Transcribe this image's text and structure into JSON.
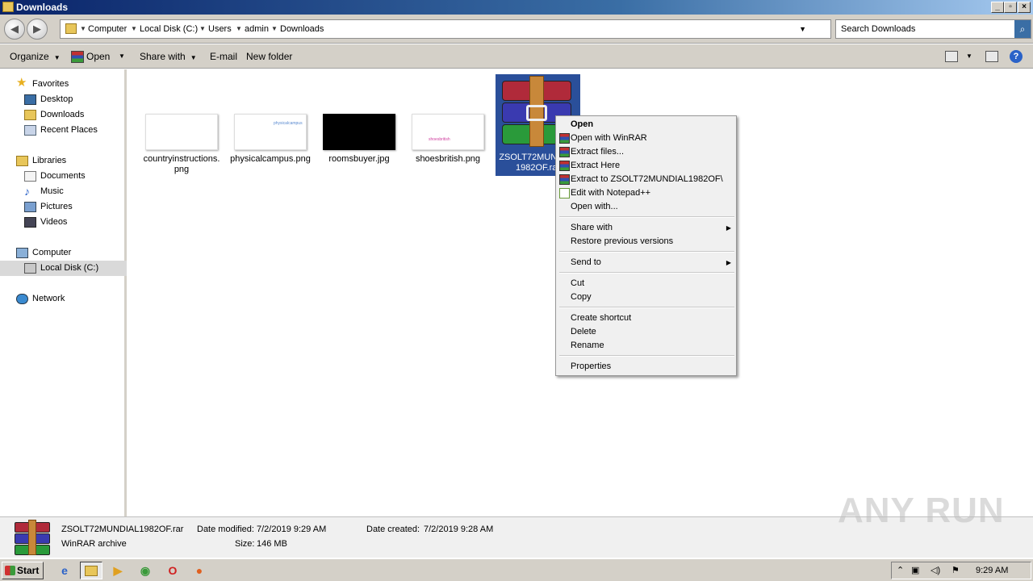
{
  "window": {
    "title": "Downloads"
  },
  "address": {
    "path": [
      "Computer",
      "Local Disk (C:)",
      "Users",
      "admin",
      "Downloads"
    ],
    "search_placeholder": "Search Downloads"
  },
  "toolbar": {
    "organize": "Organize",
    "open": "Open",
    "share_with": "Share with",
    "email": "E-mail",
    "new_folder": "New folder"
  },
  "nav": {
    "favorites": "Favorites",
    "desktop": "Desktop",
    "downloads": "Downloads",
    "recent_places": "Recent Places",
    "libraries": "Libraries",
    "documents": "Documents",
    "music": "Music",
    "pictures": "Pictures",
    "videos": "Videos",
    "computer": "Computer",
    "local_disk": "Local Disk (C:)",
    "network": "Network"
  },
  "files": [
    {
      "name": "countryinstructions.png",
      "thumb_text": "",
      "thumb_color": "#cccccc"
    },
    {
      "name": "physicalcampus.png",
      "thumb_text": "physicalcampus",
      "thumb_color": "#5a8ad0"
    },
    {
      "name": "roomsbuyer.jpg",
      "thumb_text": "",
      "thumb_color": "#000000"
    },
    {
      "name": "shoesbritish.png",
      "thumb_text": "shoesbritish",
      "thumb_color": "#d040a0"
    },
    {
      "name": "ZSOLT72MUNDIAL1982OF.rar",
      "selected": true
    }
  ],
  "context_menu": {
    "items": [
      {
        "label": "Open",
        "bold": true
      },
      {
        "label": "Open with WinRAR",
        "icon": "winrar-icon"
      },
      {
        "label": "Extract files...",
        "icon": "winrar-icon"
      },
      {
        "label": "Extract Here",
        "icon": "winrar-icon"
      },
      {
        "label": "Extract to ZSOLT72MUNDIAL1982OF\\",
        "icon": "winrar-icon"
      },
      {
        "label": "Edit with Notepad++",
        "icon": "notepadpp-icon"
      },
      {
        "label": "Open with..."
      },
      {
        "label": "Share with",
        "submenu": true
      },
      {
        "label": "Restore previous versions"
      },
      {
        "label": "Send to",
        "submenu": true
      },
      {
        "label": "Cut"
      },
      {
        "label": "Copy"
      },
      {
        "label": "Create shortcut"
      },
      {
        "label": "Delete"
      },
      {
        "label": "Rename"
      },
      {
        "label": "Properties"
      }
    ]
  },
  "details": {
    "filename": "ZSOLT72MUNDIAL1982OF.rar",
    "type": "WinRAR archive",
    "date_modified_label": "Date modified:",
    "date_modified": "7/2/2019 9:29 AM",
    "date_created_label": "Date created:",
    "date_created": "7/2/2019 9:28 AM",
    "size_label": "Size:",
    "size": "146 MB"
  },
  "watermark": "ANY RUN",
  "taskbar": {
    "start": "Start",
    "clock": "9:29 AM"
  }
}
